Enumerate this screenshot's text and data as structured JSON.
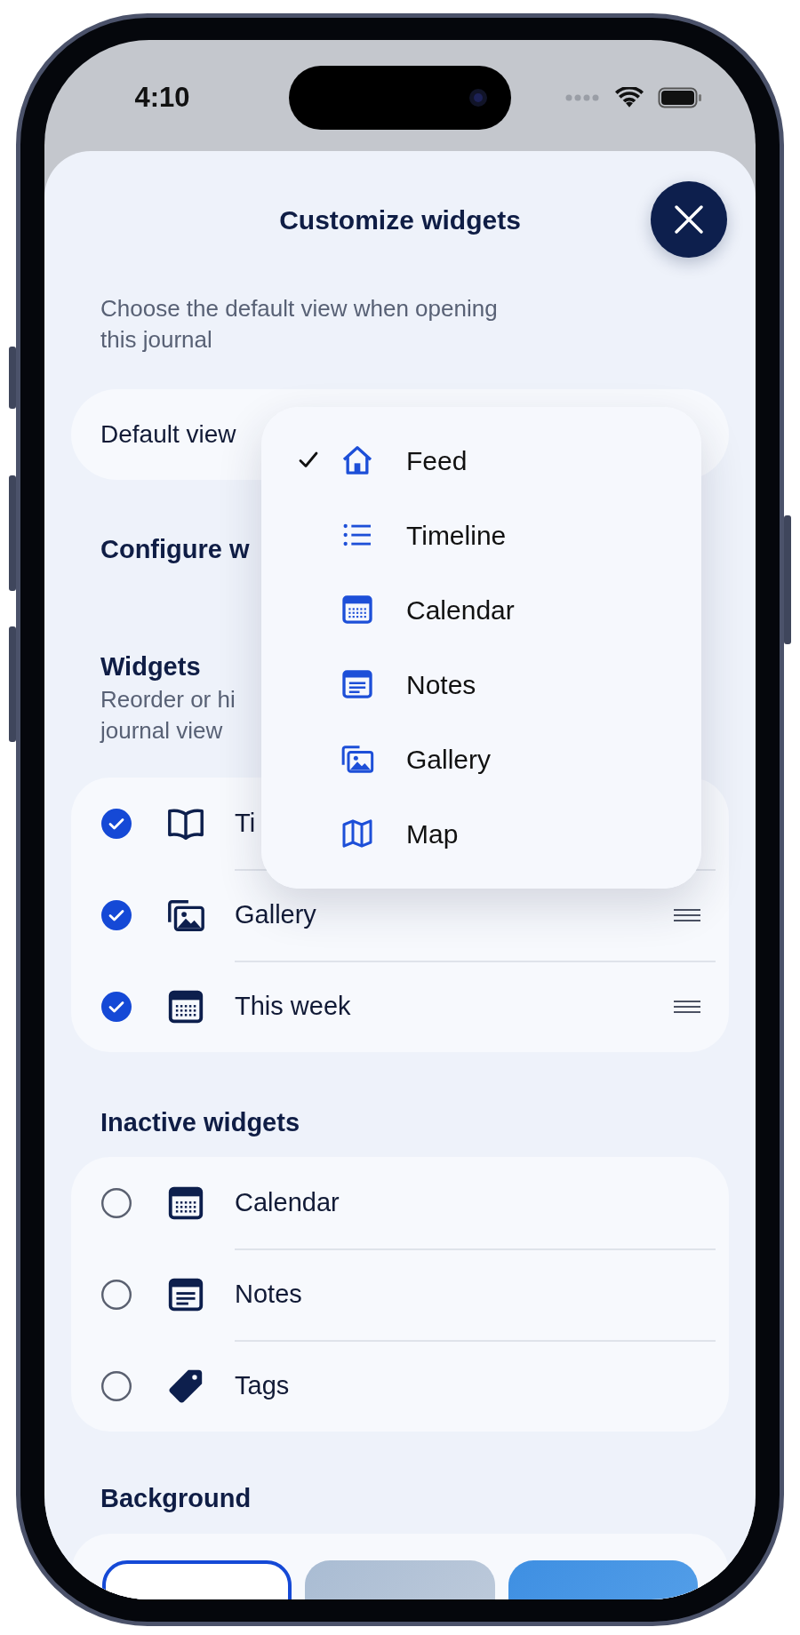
{
  "status_bar": {
    "time": "4:10"
  },
  "sheet": {
    "title": "Customize widgets",
    "description": "Choose the default view when opening this journal",
    "default_view_label": "Default view",
    "configure_heading": "Configure w"
  },
  "widgets": {
    "title": "Widgets",
    "description_lines": [
      "Reorder or hi",
      "journal view"
    ],
    "items": [
      {
        "label": "Ti",
        "checked": true,
        "handle_visible": false
      },
      {
        "label": "Gallery",
        "checked": true,
        "handle_visible": true
      },
      {
        "label": "This week",
        "checked": true,
        "handle_visible": true
      }
    ]
  },
  "inactive_widgets": {
    "title": "Inactive widgets",
    "items": [
      {
        "label": "Calendar",
        "checked": false,
        "handle_visible": false
      },
      {
        "label": "Notes",
        "checked": false,
        "handle_visible": false
      },
      {
        "label": "Tags",
        "checked": false,
        "handle_visible": false
      }
    ]
  },
  "background": {
    "title": "Background",
    "options": [
      {
        "color": "#ffffff",
        "selected": true
      },
      {
        "color": "#a9bcd3",
        "selected": false
      },
      {
        "color": "#3e8fe2",
        "selected": false
      }
    ]
  },
  "view_menu": {
    "items": [
      {
        "label": "Feed",
        "selected": true
      },
      {
        "label": "Timeline",
        "selected": false
      },
      {
        "label": "Calendar",
        "selected": false
      },
      {
        "label": "Notes",
        "selected": false
      },
      {
        "label": "Gallery",
        "selected": false
      },
      {
        "label": "Map",
        "selected": false
      }
    ]
  }
}
